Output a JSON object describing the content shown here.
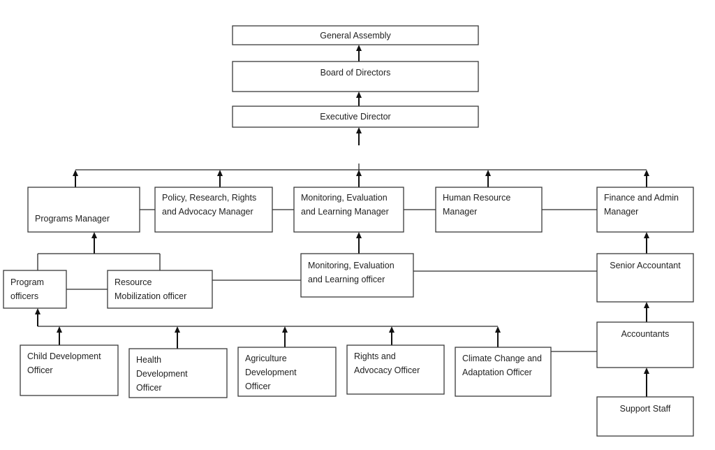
{
  "diagram": {
    "type": "organizational-chart",
    "nodes": {
      "general_assembly": {
        "lines": [
          "General Assembly"
        ]
      },
      "board_of_directors": {
        "lines": [
          "Board of Directors"
        ]
      },
      "executive_director": {
        "lines": [
          "Executive Director"
        ]
      },
      "programs_manager": {
        "lines": [
          "Programs Manager"
        ]
      },
      "policy_manager": {
        "lines": [
          "Policy, Research, Rights",
          "and Advocacy Manager"
        ]
      },
      "mel_manager": {
        "lines": [
          "Monitoring, Evaluation",
          "and Learning Manager"
        ]
      },
      "hr_manager": {
        "lines": [
          "Human Resource",
          "Manager"
        ]
      },
      "finance_manager": {
        "lines": [
          "Finance and Admin",
          "Manager"
        ]
      },
      "program_officers": {
        "lines": [
          "Program",
          "officers"
        ]
      },
      "resource_mobilization_officer": {
        "lines": [
          "Resource",
          "Mobilization officer"
        ]
      },
      "mel_officer": {
        "lines": [
          "Monitoring, Evaluation",
          "and Learning officer"
        ]
      },
      "senior_accountant": {
        "lines": [
          "Senior Accountant"
        ]
      },
      "accountants": {
        "lines": [
          "Accountants"
        ]
      },
      "support_staff": {
        "lines": [
          "Support Staff"
        ]
      },
      "child_development_officer": {
        "lines": [
          "Child Development",
          "Officer"
        ]
      },
      "health_development_officer": {
        "lines": [
          "Health",
          "Development",
          "Officer"
        ]
      },
      "agriculture_development_officer": {
        "lines": [
          "Agriculture",
          "Development",
          "Officer"
        ]
      },
      "rights_advocacy_officer": {
        "lines": [
          "Rights and",
          "Advocacy Officer"
        ]
      },
      "climate_change_officer": {
        "lines": [
          "Climate Change and",
          "Adaptation Officer"
        ]
      }
    },
    "edges": [
      {
        "from": "board_of_directors",
        "to": "general_assembly",
        "kind": "arrow"
      },
      {
        "from": "executive_director",
        "to": "board_of_directors",
        "kind": "arrow"
      },
      {
        "from": "managers_bus",
        "to": "executive_director",
        "kind": "arrow"
      },
      {
        "from": "programs_manager",
        "to": "managers_bus",
        "kind": "arrow"
      },
      {
        "from": "policy_manager",
        "to": "managers_bus",
        "kind": "arrow"
      },
      {
        "from": "mel_manager",
        "to": "managers_bus",
        "kind": "arrow"
      },
      {
        "from": "hr_manager",
        "to": "managers_bus",
        "kind": "arrow"
      },
      {
        "from": "finance_manager",
        "to": "managers_bus",
        "kind": "arrow"
      },
      {
        "from": "programs_manager",
        "to": "policy_manager",
        "kind": "line"
      },
      {
        "from": "policy_manager",
        "to": "mel_manager",
        "kind": "line"
      },
      {
        "from": "mel_manager",
        "to": "hr_manager",
        "kind": "line"
      },
      {
        "from": "hr_manager",
        "to": "finance_manager",
        "kind": "line"
      },
      {
        "from": "program_officers",
        "to": "programs_manager",
        "kind": "arrow"
      },
      {
        "from": "resource_mobilization_officer",
        "to": "programs_manager",
        "kind": "arrow"
      },
      {
        "from": "program_officers",
        "to": "resource_mobilization_officer",
        "kind": "line"
      },
      {
        "from": "resource_mobilization_officer",
        "to": "mel_officer",
        "kind": "line"
      },
      {
        "from": "mel_officer",
        "to": "mel_manager",
        "kind": "arrow"
      },
      {
        "from": "mel_officer",
        "to": "senior_accountant",
        "kind": "line"
      },
      {
        "from": "senior_accountant",
        "to": "finance_manager",
        "kind": "arrow"
      },
      {
        "from": "accountants",
        "to": "senior_accountant",
        "kind": "arrow"
      },
      {
        "from": "support_staff",
        "to": "accountants",
        "kind": "arrow"
      },
      {
        "from": "child_development_officer",
        "to": "program_officers",
        "kind": "arrow"
      },
      {
        "from": "health_development_officer",
        "to": "program_officers",
        "kind": "arrow"
      },
      {
        "from": "agriculture_development_officer",
        "to": "program_officers",
        "kind": "arrow"
      },
      {
        "from": "rights_advocacy_officer",
        "to": "program_officers",
        "kind": "arrow"
      },
      {
        "from": "climate_change_officer",
        "to": "program_officers",
        "kind": "arrow"
      },
      {
        "from": "climate_change_officer",
        "to": "accountants",
        "kind": "line"
      }
    ]
  }
}
